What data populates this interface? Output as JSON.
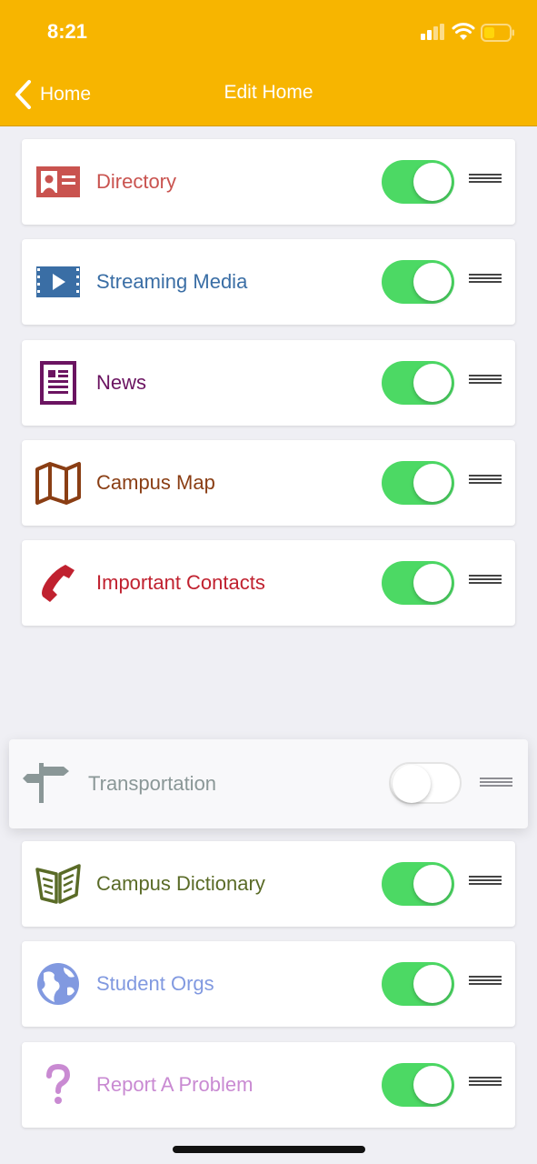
{
  "status_bar": {
    "time": "8:21"
  },
  "nav": {
    "back_label": "Home",
    "title": "Edit Home"
  },
  "items": [
    {
      "label": "Directory",
      "icon": "contact-card-icon",
      "color": "#c9534f",
      "enabled": true
    },
    {
      "label": "Streaming Media",
      "icon": "film-play-icon",
      "color": "#3a6ea5",
      "enabled": true
    },
    {
      "label": "News",
      "icon": "newspaper-icon",
      "color": "#6b1461",
      "enabled": true
    },
    {
      "label": "Campus Map",
      "icon": "folded-map-icon",
      "color": "#8a3e14",
      "enabled": true
    },
    {
      "label": "Important Contacts",
      "icon": "phone-icon",
      "color": "#c0212f",
      "enabled": true
    },
    {
      "label": "Transportation",
      "icon": "signpost-icon",
      "color": "#8a9797",
      "enabled": false
    },
    {
      "label": "Campus Dictionary",
      "icon": "open-book-icon",
      "color": "#5a6b27",
      "enabled": true
    },
    {
      "label": "Student Orgs",
      "icon": "globe-icon",
      "color": "#8199e0",
      "enabled": true
    },
    {
      "label": "Report A Problem",
      "icon": "question-mark-icon",
      "color": "#c98ad2",
      "enabled": true
    }
  ],
  "colors": {
    "header": "#f7b500",
    "toggle_on": "#4cd964"
  }
}
